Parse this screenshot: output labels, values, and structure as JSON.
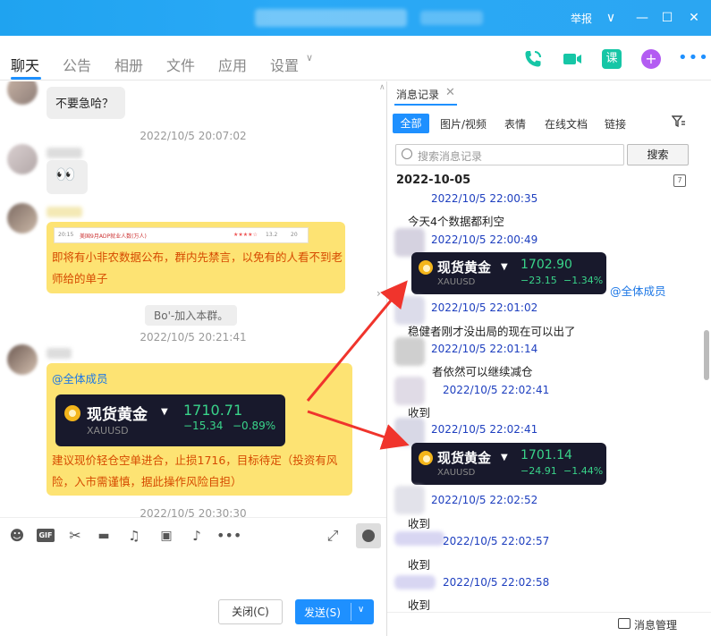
{
  "window": {
    "report_label": "举报",
    "minimize": "—",
    "maximize": "☐",
    "close": "✕",
    "menu": "∨"
  },
  "nav": {
    "tabs": [
      {
        "label": "聊天"
      },
      {
        "label": "公告"
      },
      {
        "label": "相册"
      },
      {
        "label": "文件"
      },
      {
        "label": "应用"
      },
      {
        "label": "设置"
      }
    ],
    "course_label": "课"
  },
  "chat": {
    "messages": {
      "m1": "不要急哈？",
      "m2": "👀",
      "m3_text": "即将有小非农数据公布，群内先禁言，以免有的人看不到老师给的单子",
      "m4_mention": "@全体成员",
      "m4_text": "建议现价轻仓空单进合，止损1716，目标待定（投资有风险，入市需谨慎，据此操作风险自担）"
    },
    "timestamps": {
      "t1": "2022/10/5 20:07:02",
      "t2": "2022/10/5 20:21:41",
      "t3": "2022/10/5 20:30:30"
    },
    "system_notice": "Bo'-加入本群。",
    "strip": {
      "time": "20:15",
      "event": "美国9月ADP就业人数(万人)",
      "stars": "★★★★☆",
      "prev": "13.2",
      "forecast": "20"
    },
    "gold_card": {
      "name": "现货黄金",
      "code": "XAUUSD",
      "price": "1710.71",
      "change": "−15.34",
      "change_pct": "−0.89%"
    }
  },
  "composer": {
    "close_label": "关闭(C)",
    "send_label": "发送(S)"
  },
  "history": {
    "tab_title": "消息记录",
    "filters": [
      "全部",
      "图片/视频",
      "表情",
      "在线文档",
      "链接"
    ],
    "search_placeholder": "搜索消息记录",
    "search_button": "搜索",
    "date": "2022-10-05",
    "calendar_day": "7",
    "entries": [
      {
        "time": "2022/10/5 22:00:35",
        "text": "今天4个数据都利空"
      },
      {
        "time": "2022/10/5 22:00:49",
        "text": ""
      },
      {
        "time": "2022/10/5 22:01:02",
        "text": "稳健者刚才没出局的现在可以出了"
      },
      {
        "time": "2022/10/5 22:01:14",
        "text": "者依然可以继续减仓"
      },
      {
        "time": "2022/10/5 22:02:41",
        "text": "收到"
      },
      {
        "time": "2022/10/5 22:02:41",
        "text": ""
      },
      {
        "time": "2022/10/5 22:02:52",
        "text": "收到"
      },
      {
        "time": "2022/10/5 22:02:57",
        "text": "收到"
      },
      {
        "time": "2022/10/5 22:02:58",
        "text": "收到"
      }
    ],
    "mention": "@全体成员",
    "card1": {
      "name": "现货黄金",
      "code": "XAUUSD",
      "price": "1702.90",
      "change": "−23.15",
      "change_pct": "−1.34%"
    },
    "card2": {
      "name": "现货黄金",
      "code": "XAUUSD",
      "price": "1701.14",
      "change": "−24.91",
      "change_pct": "−1.44%"
    },
    "manage_label": "消息管理"
  },
  "colors": {
    "accent": "#1e90ff",
    "titlebar": "#2aa9f6",
    "highlight": "#fde373",
    "card_bg": "#18192c",
    "gain_loss": "#39d48a",
    "arrow": "#f0342c"
  }
}
